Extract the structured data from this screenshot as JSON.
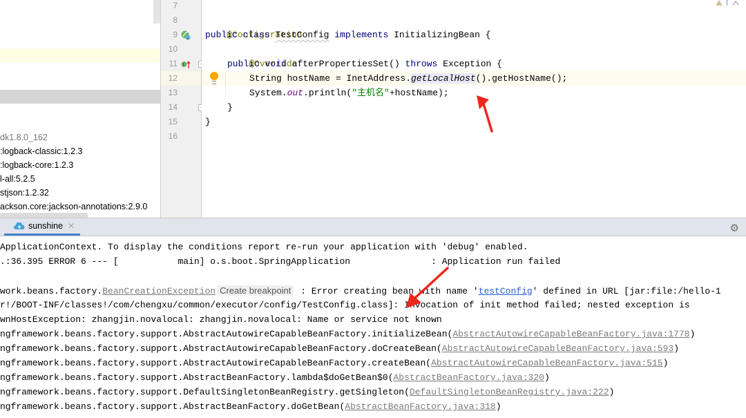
{
  "project_tree": {
    "items": [
      {
        "label": "dk1.8.0_162",
        "kind": "sdk"
      },
      {
        "label": ":logback-classic:1.2.3",
        "kind": "library"
      },
      {
        "label": ":logback-core:1.2.3",
        "kind": "library"
      },
      {
        "label": "l-all:5.2.5",
        "kind": "library"
      },
      {
        "label": "stjson:1.2.32",
        "kind": "library"
      },
      {
        "label": "ackson.core:jackson-annotations:2.9.0",
        "kind": "library"
      }
    ]
  },
  "editor": {
    "line_numbers": [
      "7",
      "8",
      "9",
      "10",
      "11",
      "12",
      "13",
      "14",
      "15",
      "16"
    ],
    "lines": {
      "l8": {
        "annotation": "@Configuration"
      },
      "l9": {
        "kw1": "public",
        "kw2": "class",
        "class_name": "TestConfig",
        "kw3": "implements",
        "iface": "InitializingBean",
        "brace": " {"
      },
      "l10": {
        "annotation": "@Override"
      },
      "l11": {
        "kw1": "public",
        "kw2": "void",
        "method": "afterPropertiesSet",
        "params": "()",
        "kw3": "throws",
        "exc": "Exception",
        "brace": " {"
      },
      "l12": {
        "prefix": "String hostName = InetAddress.",
        "call": "getLocalHost",
        "suffix": "().getHostName();"
      },
      "l13": {
        "prefix": "System.",
        "field": "out",
        "mid": ".println(",
        "string": "\"主机名\"",
        "suffix": "+hostName);"
      },
      "l14": {
        "text": "}"
      },
      "l15": {
        "text": "}"
      }
    },
    "gutter_icons": {
      "l9": "spring-bean-icon",
      "l11": "implements-method-icon"
    },
    "intention_icon": "lightbulb-icon",
    "inspection_icon": "warning-icon"
  },
  "run_panel": {
    "tab_label": "sunshine",
    "tab_icon": "spring-boot-cloud-icon",
    "settings_icon": "gear-icon"
  },
  "console": {
    "lines": [
      {
        "text": "ApplicationContext. To display the conditions report re-run your application with 'debug' enabled."
      },
      {
        "text": ".:36.395 ERROR 6 --- [           main] o.s.boot.SpringApplication               : Application run failed"
      },
      {
        "text": ""
      },
      {
        "pre": "work.beans.factory.",
        "link": "BeanCreationException",
        "chip": "Create breakpoint",
        "mid": " : Error creating bean with name '",
        "bean_link": "testConfig",
        "post": "' defined in URL [jar:file:/hello-1"
      },
      {
        "text": "r!/BOOT-INF/classes!/com/chengxu/common/executor/config/TestConfig.class]: Invocation of init method failed; nested exception is"
      },
      {
        "text": "wnHostException: zhangjin.novalocal: zhangjin.novalocal: Name or service not known"
      }
    ],
    "stack": [
      {
        "frame": "ngframework.beans.factory.support.AbstractAutowireCapableBeanFactory.initializeBean(",
        "source": "AbstractAutowireCapableBeanFactory.java:1778",
        "close": ")"
      },
      {
        "frame": "ngframework.beans.factory.support.AbstractAutowireCapableBeanFactory.doCreateBean(",
        "source": "AbstractAutowireCapableBeanFactory.java:593",
        "close": ")"
      },
      {
        "frame": "ngframework.beans.factory.support.AbstractAutowireCapableBeanFactory.createBean(",
        "source": "AbstractAutowireCapableBeanFactory.java:515",
        "close": ")"
      },
      {
        "frame": "ngframework.beans.factory.support.AbstractBeanFactory.lambda$doGetBean$0(",
        "source": "AbstractBeanFactory.java:320",
        "close": ")"
      },
      {
        "frame": "ngframework.beans.factory.support.DefaultSingletonBeanRegistry.getSingleton(",
        "source": "DefaultSingletonBeanRegistry.java:222",
        "close": ")"
      },
      {
        "frame": "ngframework.beans.factory.support.AbstractBeanFactory.doGetBean(",
        "source": "AbstractBeanFactory.java:318",
        "close": ")"
      }
    ]
  },
  "colors": {
    "annotation_arrow": "#f0261c",
    "keyword": "#000080",
    "annotation": "#808000",
    "string": "#008000",
    "link": "#2660c8",
    "tab_underline": "#4083c9"
  }
}
